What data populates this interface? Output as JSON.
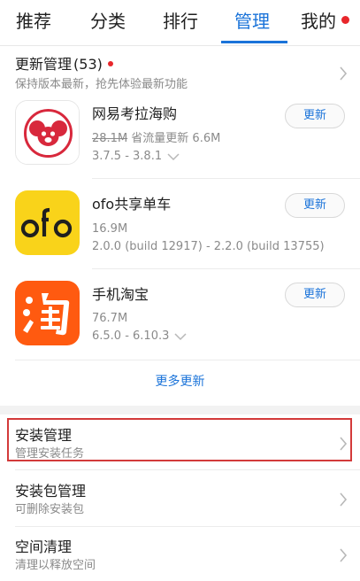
{
  "tabs": [
    {
      "label": "推荐"
    },
    {
      "label": "分类"
    },
    {
      "label": "排行"
    },
    {
      "label": "管理"
    },
    {
      "label": "我的"
    }
  ],
  "active_tab": "管理",
  "updates": {
    "title": "更新管理",
    "count": "(53)",
    "subtitle": "保持版本最新，抢先体验最新功能",
    "more_label": "更多更新"
  },
  "apps": [
    {
      "name": "网易考拉海购",
      "size_old": "28.1M",
      "size_note": " 省流量更新 6.6M",
      "version": "3.7.5 - 3.8.1",
      "button": "更新",
      "icon": "koala-icon"
    },
    {
      "name": "ofo共享单车",
      "size": "16.9M",
      "version": "2.0.0 (build 12917) - 2.2.0 (build 13755)",
      "button": "更新",
      "icon": "ofo-icon"
    },
    {
      "name": "手机淘宝",
      "size": "76.7M",
      "version": "6.5.0 - 6.10.3",
      "button": "更新",
      "icon": "taobao-icon"
    }
  ],
  "management": [
    {
      "title": "安装管理",
      "subtitle": "管理安装任务"
    },
    {
      "title": "安装包管理",
      "subtitle": "可删除安装包"
    },
    {
      "title": "空间清理",
      "subtitle": "清理以释放空间"
    }
  ],
  "colors": {
    "accent": "#1a73d9",
    "badge": "#e8262b",
    "highlight_border": "#d33a3a",
    "ofo_yellow": "#f9d31a",
    "taobao_orange": "#ff5a10",
    "koala_red": "#d8283c"
  }
}
